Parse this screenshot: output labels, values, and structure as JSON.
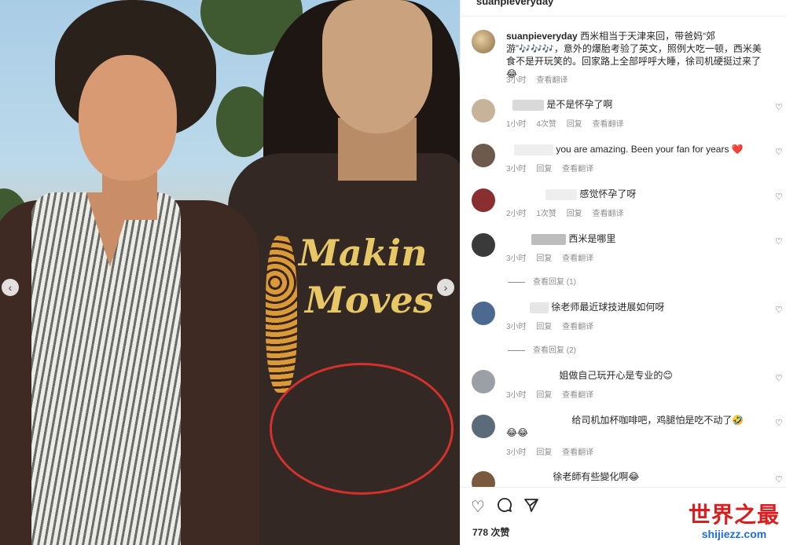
{
  "post": {
    "header_username": "suanpieveryday",
    "caption": {
      "username": "suanpieveryday",
      "text": "西米相当于天津来回，带爸妈“郊游”🎶🎶🎶，意外的爆胎考验了英文，照例大吃一顿，西米美食不是开玩笑的。回家路上全部呼呼大睡，徐司机硬挺过来了😂",
      "time": "3小时",
      "translate": "查看翻译"
    },
    "photo": {
      "shirt_print_line1": "Makin",
      "shirt_print_line2": "Moves",
      "prev_arrow": "‹",
      "next_arrow": "›"
    }
  },
  "comments": [
    {
      "text": "是不是怀孕了啊",
      "time": "1小时",
      "likes": "4次赞",
      "reply": "回复",
      "translate": "查看翻译"
    },
    {
      "text": "you are amazing. Been your fan for years ❤️",
      "time": "3小时",
      "likes": "",
      "reply": "回复",
      "translate": "查看翻译"
    },
    {
      "text": "感觉怀孕了呀",
      "time": "2小时",
      "likes": "1次赞",
      "reply": "回复",
      "translate": "查看翻译"
    },
    {
      "text": "西米是哪里",
      "time": "3小时",
      "likes": "",
      "reply": "回复",
      "translate": "查看翻译",
      "view_replies": "查看回复 (1)"
    },
    {
      "text": "徐老师最近球技进展如何呀",
      "time": "3小时",
      "likes": "",
      "reply": "回复",
      "translate": "查看翻译",
      "view_replies": "查看回复 (2)"
    },
    {
      "text": "姐做自己玩开心是专业的😊",
      "time": "3小时",
      "likes": "",
      "reply": "回复",
      "translate": "查看翻译"
    },
    {
      "text": "给司机加杯咖啡吧，鸡腿怕是吃不动了🤣",
      "text_line2": "😂😂",
      "time": "3小时",
      "likes": "",
      "reply": "回复",
      "translate": "查看翻译"
    },
    {
      "text": "徐老師有些變化啊😂",
      "time": "",
      "likes": "",
      "reply": "",
      "translate": ""
    }
  ],
  "actions": {
    "like_icon": "heart-outline",
    "comment_icon": "speech-bubble",
    "share_icon": "paper-plane",
    "like_count": "778 次赞"
  },
  "watermark": {
    "main": "世界之最",
    "sub": "shijiezz.com"
  },
  "colors": {
    "circle": "#d2322b",
    "watermark_red": "#d81e1e",
    "watermark_blue": "#1e6fd9",
    "meta_gray": "#8e8e8e"
  }
}
